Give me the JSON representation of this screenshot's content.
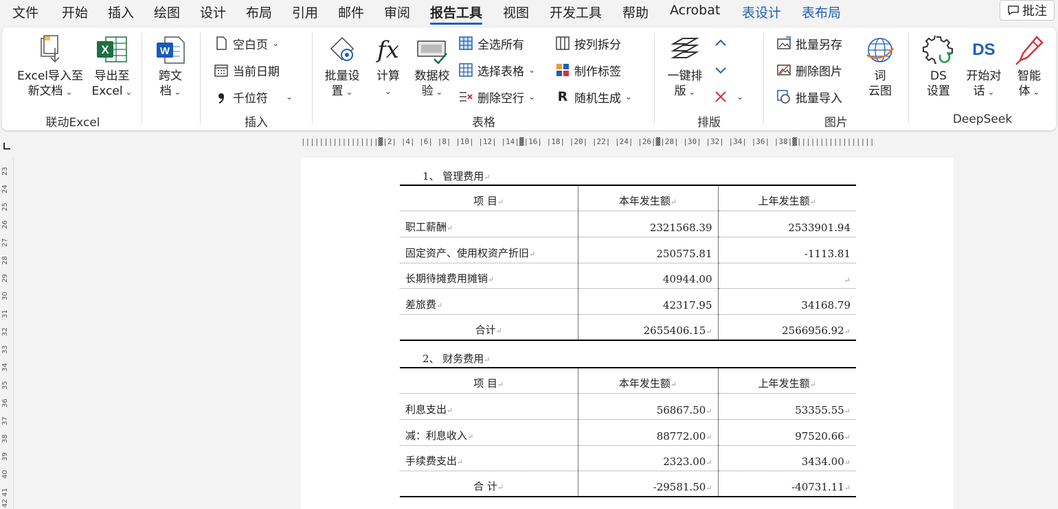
{
  "menu": {
    "items": [
      "文件",
      "开始",
      "插入",
      "绘图",
      "设计",
      "布局",
      "引用",
      "邮件",
      "审阅",
      "报告工具",
      "视图",
      "开发工具",
      "帮助",
      "Acrobat",
      "表设计",
      "表布局"
    ],
    "active": "报告工具",
    "comment": "批注"
  },
  "ribbon": {
    "groups": {
      "linkexcel": "联动Excel",
      "insert": "插入",
      "table": "表格",
      "layout": "排版",
      "picture": "图片",
      "deepseek": "DeepSeek"
    },
    "excel_import_1": "Excel导入至",
    "excel_import_2": "新文档",
    "export_1": "导出至",
    "export_2": "Excel",
    "cross_1": "跨文",
    "cross_2": "档",
    "blank_page": "空白页",
    "current_date": "当前日期",
    "thousands": "千位符",
    "batch_1": "批量设",
    "batch_2": "置",
    "calc": "计算",
    "check_1": "数据校",
    "check_2": "验",
    "select_all": "全选所有",
    "select_table": "选择表格",
    "delete_empty": "删除空行",
    "split_col": "按列拆分",
    "make_label": "制作标签",
    "random_gen": "随机生成",
    "onekey_1": "一键排",
    "onekey_2": "版",
    "save_as": "批量另存",
    "delete_pic": "删除图片",
    "batch_import": "批量导入",
    "wordcloud_1": "词",
    "wordcloud_2": "云图",
    "ds_settings_1": "DS",
    "ds_settings_2": "设置",
    "start_check_1": "开始对",
    "start_check_2": "话",
    "smart_1": "智能",
    "smart_2": "体",
    "ds_logo": "DS",
    "fx": "fx",
    "r_letter": "R"
  },
  "ruler": {
    "text": "|||||||||||||||||▓|2| |4| |6| |8| |10| |12| |14|▓|16| |18| |20| |22| |24| |26|▓|28| |30| |32| |34| |36| |38|▓|||||||||||||||||",
    "vertical": [
      "23",
      "24",
      "25",
      "26",
      "27",
      "28",
      "29",
      "30",
      "31",
      "32",
      "33",
      "34",
      "35",
      "36",
      "37",
      "38",
      "39",
      "40",
      "41",
      "42"
    ]
  },
  "doc": {
    "section1": "1、 管理费用",
    "section2": "2、 财务费用",
    "table1": {
      "header": [
        "项    目",
        "本年发生额",
        "上年发生额"
      ],
      "rows": [
        [
          "职工薪酬",
          "2321568.39",
          "2533901.94"
        ],
        [
          "固定资产、使用权资产折旧",
          "250575.81",
          "-1113.81"
        ],
        [
          "长期待摊费用摊销",
          "40944.00",
          ""
        ],
        [
          "差旅费",
          "42317.95",
          "34168.79"
        ]
      ],
      "total": [
        "合计",
        "2655406.15",
        "2566956.92"
      ]
    },
    "table2": {
      "header": [
        "项    目",
        "本年发生额",
        "上年发生额"
      ],
      "rows": [
        [
          "利息支出",
          "56867.50",
          "53355.55"
        ],
        [
          "减：利息收入",
          "88772.00",
          "97520.66"
        ],
        [
          "手续费支出",
          "2323.00",
          "3434.00"
        ]
      ],
      "total": [
        "合   计",
        "-29581.50",
        "-40731.11"
      ]
    }
  },
  "colors": {
    "accent": "#1f5fb8",
    "excel_green": "#1d7044",
    "word_blue": "#185abd",
    "red": "#d13438"
  }
}
